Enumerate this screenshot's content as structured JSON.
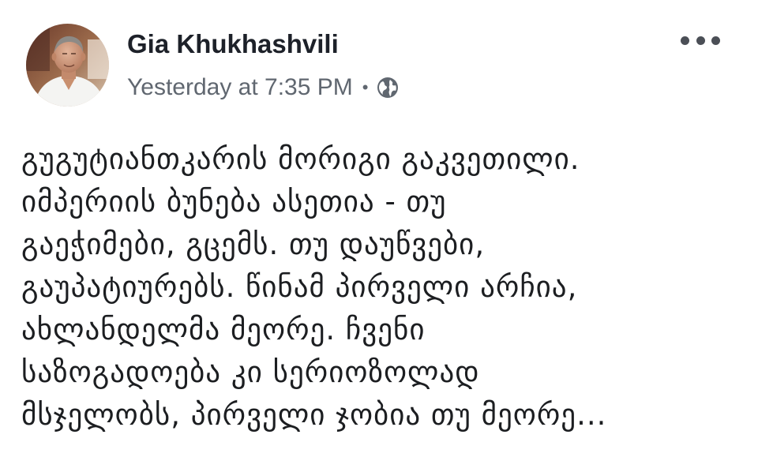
{
  "post": {
    "author": {
      "name": "Gia Khukhashvili",
      "avatar_icon": "profile-photo"
    },
    "meta": {
      "timestamp": "Yesterday at 7:35 PM",
      "separator": "•",
      "privacy_icon": "globe-icon"
    },
    "menu_icon": "more-options-icon",
    "body_lines": [
      "გუგუტიანთკარის მორიგი გაკვეთილი.",
      "იმპერიის ბუნება ასეთია - თუ",
      "გაეჭიმები, გცემს. თუ დაუწვები,",
      "გაუპატიურებს. წინამ პირველი არჩია,",
      "ახლანდელმა მეორე. ჩვენი",
      "საზოგადოება კი სერიოზოლად",
      "მსჯელობს, პირველი ჯობია თუ მეორე..."
    ]
  },
  "colors": {
    "name": "#1d2129",
    "meta_text": "#606770",
    "body_text": "#1c1e21",
    "icon_gray": "#4b4f56",
    "background": "#ffffff"
  }
}
